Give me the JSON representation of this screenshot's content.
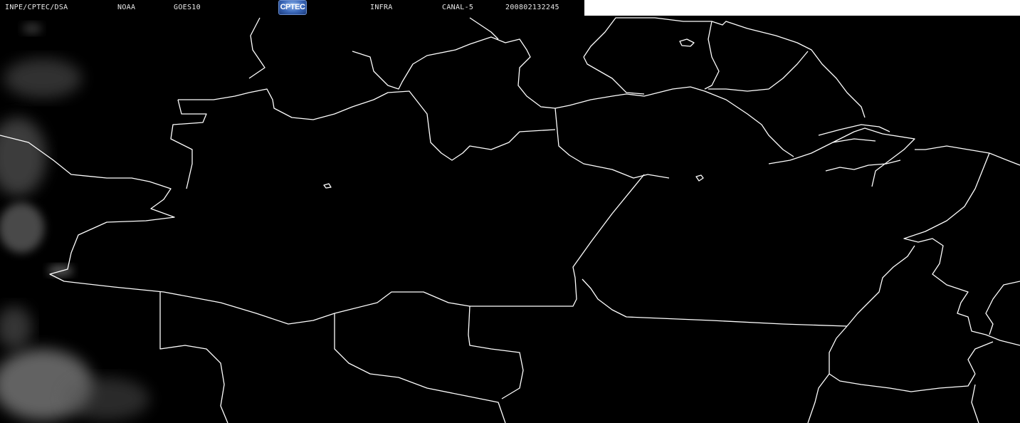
{
  "header": {
    "source": "INPE/CPTEC/DSA",
    "agency": "NOAA",
    "satellite": "GOES10",
    "logo_text": "CPTEC",
    "band": "INFRA",
    "channel": "CANAL-5",
    "timestamp": "200802132245"
  },
  "map": {
    "type": "infrared satellite image",
    "background_color": "#000000",
    "boundary_color": "#ffffff",
    "cloud_color": "#808080",
    "header_fill_color": "#ffffff",
    "logo_color": "#3a67b8"
  }
}
